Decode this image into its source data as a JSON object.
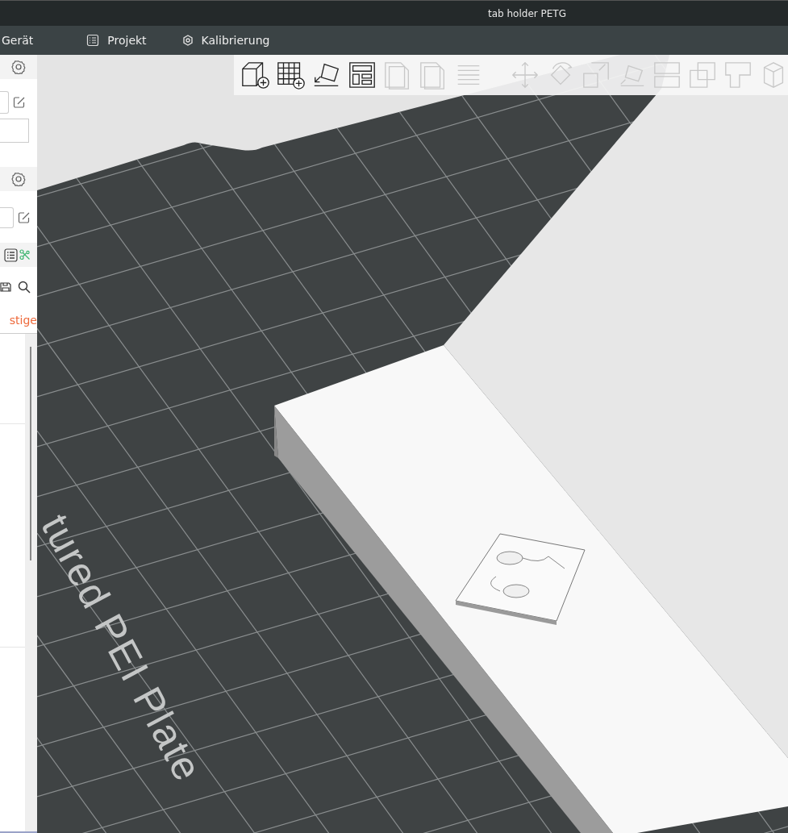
{
  "window": {
    "title": "tab holder PETG"
  },
  "menu": [
    {
      "label": "Gerät"
    },
    {
      "label": "Projekt"
    },
    {
      "label": "Kalibrierung"
    }
  ],
  "sidebar": {
    "tabs": [
      {
        "label": "stige",
        "selected": true
      }
    ]
  },
  "toolbar": [
    {
      "disabled": false
    },
    {
      "disabled": false
    },
    {
      "disabled": false
    },
    {
      "disabled": false
    },
    {
      "disabled": true
    },
    {
      "disabled": true
    },
    {
      "disabled": true
    },
    {
      "disabled": true
    },
    {
      "disabled": true
    },
    {
      "disabled": true
    },
    {
      "disabled": true
    },
    {
      "disabled": true
    },
    {
      "disabled": true
    },
    {
      "disabled": true
    },
    {
      "disabled": true
    }
  ],
  "viewport": {
    "plate_label": "tured PEI Plate"
  }
}
